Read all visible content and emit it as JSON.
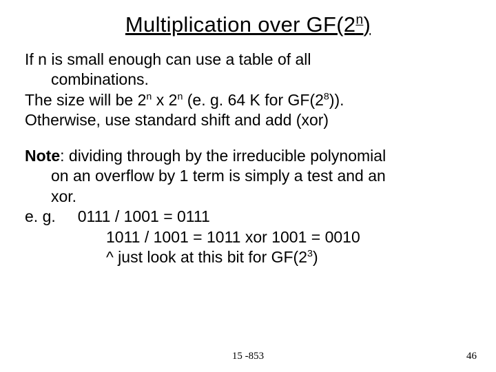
{
  "title_a": "Multiplication over GF(2",
  "title_sup": "n",
  "title_b": ")",
  "p1a": "If n is small enough can use a table of all",
  "p1b": "combinations.",
  "p2a": "The size will be 2",
  "p2b": " x 2",
  "p2c": " (e. g. 64 K for GF(2",
  "p2d": ")).",
  "sup_n1": "n",
  "sup_n2": "n",
  "sup_8": "8",
  "p3": "Otherwise, use standard shift and add (xor)",
  "note_label": "Note",
  "note_a": ": dividing through by the irreducible polynomial",
  "note_b": "on an overflow by 1 term is simply a test and an",
  "note_c": "xor.",
  "eg_label": "e. g.",
  "eg_pad": "     ",
  "eg1": "0111 / 1001 = 0111",
  "eg2": "1011 / 1001 = 1011 xor 1001 = 0010",
  "eg3a": "^ just look at this bit for GF(2",
  "eg3b": ")",
  "sup_3": "3",
  "footer_center": "15 -853",
  "footer_right": "46"
}
